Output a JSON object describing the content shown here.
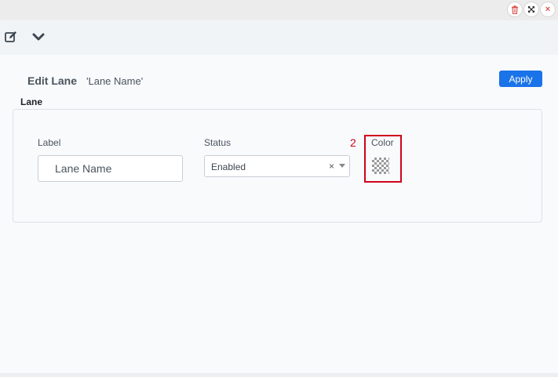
{
  "window": {
    "buttons": [
      {
        "icon": "trash-icon"
      },
      {
        "icon": "expand-icon"
      },
      {
        "icon": "close-icon",
        "glyph": "×"
      }
    ]
  },
  "toolbar": {
    "icons": [
      "edit-icon",
      "chevron-down-icon"
    ]
  },
  "form": {
    "title": "Edit Lane",
    "subtitle": "'Lane Name'",
    "apply_label": "Apply",
    "section_label": "Lane",
    "fields": {
      "label": {
        "label": "Label",
        "value": "Lane Name"
      },
      "status": {
        "label": "Status",
        "value": "Enabled",
        "clear_glyph": "×"
      },
      "color": {
        "label": "Color"
      }
    }
  },
  "annotation": {
    "number": "2",
    "color": "#d0021b"
  },
  "colors": {
    "accent": "#1a73e8",
    "annotation": "#d0021b"
  }
}
